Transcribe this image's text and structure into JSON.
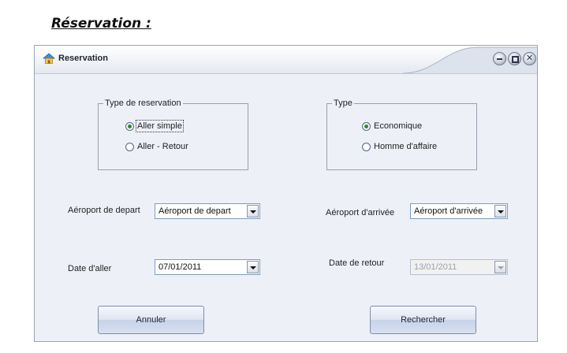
{
  "page_heading": "Réservation :",
  "window": {
    "title": "Reservation",
    "icon": "home-icon",
    "controls": [
      "minimize-icon",
      "maximize-icon",
      "close-icon"
    ]
  },
  "reservation_type": {
    "legend": "Type de reservation",
    "options": [
      {
        "label": "Aller simple",
        "checked": true
      },
      {
        "label": "Aller - Retour",
        "checked": false
      }
    ]
  },
  "class_type": {
    "legend": "Type",
    "options": [
      {
        "label": "Economique",
        "checked": true
      },
      {
        "label": "Homme d'affaire",
        "checked": false
      }
    ]
  },
  "departure_airport": {
    "label": "Aéroport de depart",
    "value": "Aéroport de depart"
  },
  "arrival_airport": {
    "label": "Aéroport d'arrivée",
    "value": "Aéroport d'arrivée"
  },
  "departure_date": {
    "label": "Date d'aller",
    "value": "07/01/2011"
  },
  "return_date": {
    "label": "Date de retour",
    "value": "13/01/2011",
    "disabled": true
  },
  "buttons": {
    "cancel": "Annuler",
    "search": "Rechercher"
  },
  "colors": {
    "radio_check": "#2a8a2a",
    "window_bg": "#eef0f8",
    "input_border": "#7f9db9"
  }
}
